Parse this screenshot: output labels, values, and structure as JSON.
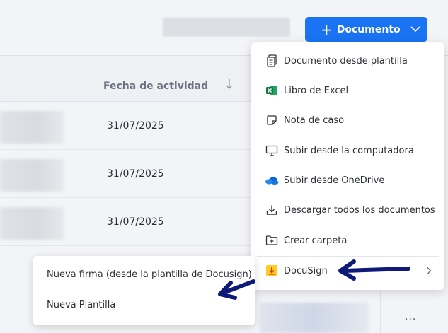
{
  "header": {
    "new_button_label": "Documento",
    "new_button_plus": "+",
    "accent_color": "#1a73f3"
  },
  "table": {
    "column_header": "Fecha de actividad",
    "rows": [
      {
        "date": "31/07/2025"
      },
      {
        "date": "31/07/2025"
      },
      {
        "date": "31/07/2025"
      }
    ],
    "more_label": "..."
  },
  "menu": {
    "items": [
      {
        "label": "Documento desde plantilla",
        "icon": "document-template-icon"
      },
      {
        "label": "Libro de Excel",
        "icon": "excel-icon"
      },
      {
        "label": "Nota de caso",
        "icon": "note-icon"
      },
      {
        "label": "Subir desde la computadora",
        "icon": "monitor-icon"
      },
      {
        "label": "Subir desde OneDrive",
        "icon": "onedrive-icon"
      },
      {
        "label": "Descargar todos los documentos",
        "icon": "download-icon"
      },
      {
        "label": "Crear carpeta",
        "icon": "folder-add-icon"
      },
      {
        "label": "DocuSign",
        "icon": "docusign-icon"
      }
    ]
  },
  "submenu": {
    "items": [
      {
        "label": "Nueva firma (desde la plantilla de Docusign)"
      },
      {
        "label": "Nueva Plantilla"
      }
    ]
  },
  "annotation_color": "#0f1a78"
}
